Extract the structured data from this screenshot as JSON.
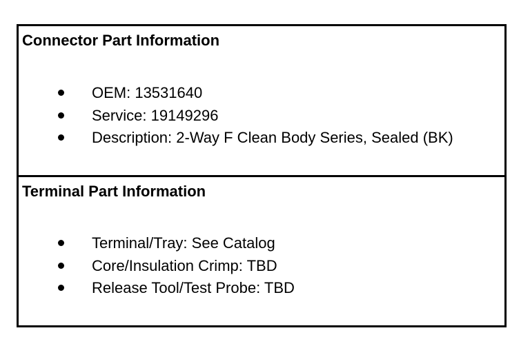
{
  "connector": {
    "title": "Connector Part Information",
    "items": [
      "OEM: 13531640",
      "Service: 19149296",
      "Description: 2-Way F Clean Body Series, Sealed (BK)"
    ]
  },
  "terminal": {
    "title": "Terminal Part Information",
    "items": [
      "Terminal/Tray: See Catalog",
      "Core/Insulation Crimp: TBD",
      "Release Tool/Test Probe: TBD"
    ]
  }
}
